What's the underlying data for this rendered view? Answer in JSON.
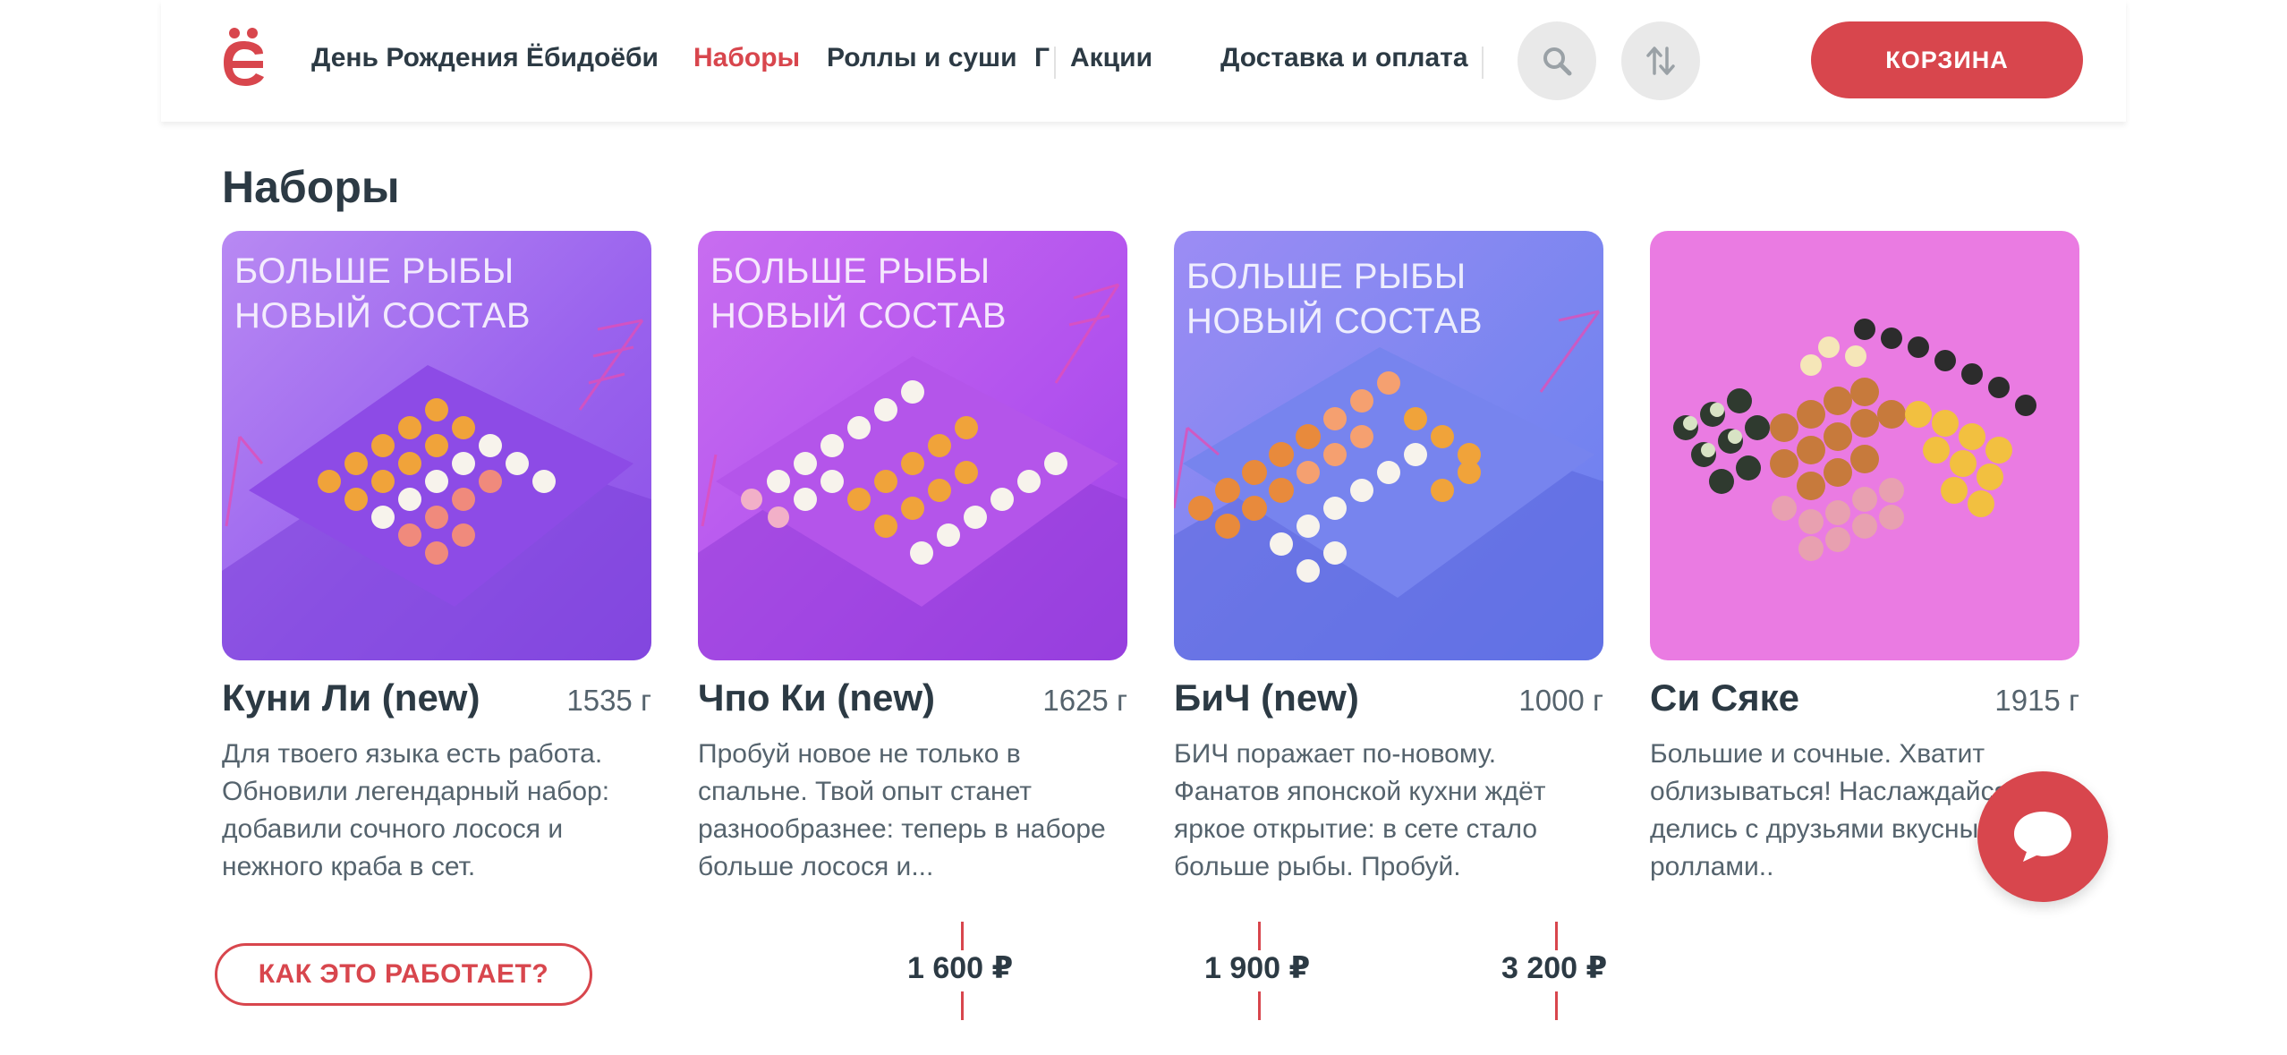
{
  "brand": {
    "accent": "#d8464d",
    "text": "#2c3a44"
  },
  "header": {
    "nav": [
      "День Рождения Ёбидоёби",
      "Наборы",
      "Роллы и суши",
      "Г",
      "Акции",
      "Доставка и оплата"
    ],
    "active_index": 1,
    "search_icon": "search-icon",
    "sort_icon": "sort-arrows-icon",
    "cart_label": "КОРЗИНА"
  },
  "section": {
    "title": "Наборы"
  },
  "products": [
    {
      "name": "Куни Ли (new)",
      "weight": "1535 г",
      "promo_line1": "БОЛЬШЕ РЫБЫ",
      "promo_line2": "НОВЫЙ СОСТАВ",
      "description": "Для твоего языка есть работа. Обновили легендарный набор: добавили сочного лосося и нежного краба в сет."
    },
    {
      "name": "Чпо Ки (new)",
      "weight": "1625 г",
      "promo_line1": "БОЛЬШЕ РЫБЫ",
      "promo_line2": "НОВЫЙ СОСТАВ",
      "description": "Пробуй новое не только в спальне. Твой опыт станет разнообразнее: теперь в наборе больше лосося и..."
    },
    {
      "name": "БиЧ (new)",
      "weight": "1000 г",
      "promo_line1": "БОЛЬШЕ РЫБЫ",
      "promo_line2": "НОВЫЙ СОСТАВ",
      "description": "БИЧ поражает по-новому. Фанатов японской кухни ждёт яркое открытие: в сете стало больше рыбы. Пробуй."
    },
    {
      "name": "Си Сяке",
      "weight": "1915 г",
      "description": "Большие и сочные. Хватит облизываться! Наслаждайся и делись с друзьями вкусными роллами.."
    }
  ],
  "how_it_works_label": "КАК ЭТО РАБОТАЕТ?",
  "prices": [
    "1 600 ₽",
    "1 900 ₽",
    "3 200 ₽"
  ],
  "chat_icon": "chat-bubble-icon"
}
